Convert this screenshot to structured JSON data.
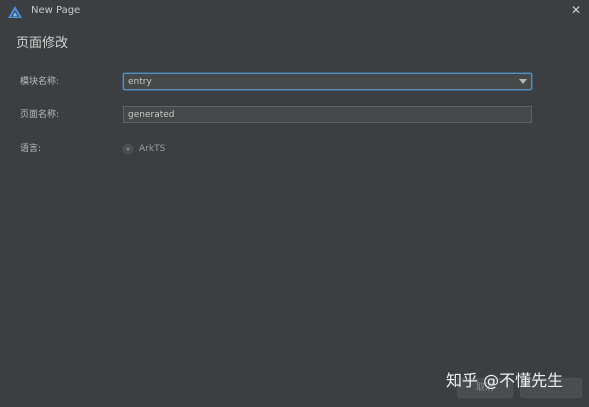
{
  "window": {
    "title": "New Page",
    "close_label": "✕"
  },
  "page": {
    "heading": "页面修改"
  },
  "form": {
    "module_label": "模块名称:",
    "module_value": "entry",
    "page_name_label": "页面名称:",
    "page_name_value": "generated",
    "language_label": "语言:",
    "language_option": "ArkTS"
  },
  "footer": {
    "cancel_label": "取消"
  },
  "watermark": {
    "text": "知乎 @不懂先生"
  },
  "icons": {
    "app_logo": "app-logo-icon",
    "dropdown": "chevron-down-icon",
    "close": "close-icon"
  },
  "colors": {
    "background": "#3c3f41",
    "focus_border": "#5a8dbd",
    "logo_accent": "#4a90e2"
  }
}
